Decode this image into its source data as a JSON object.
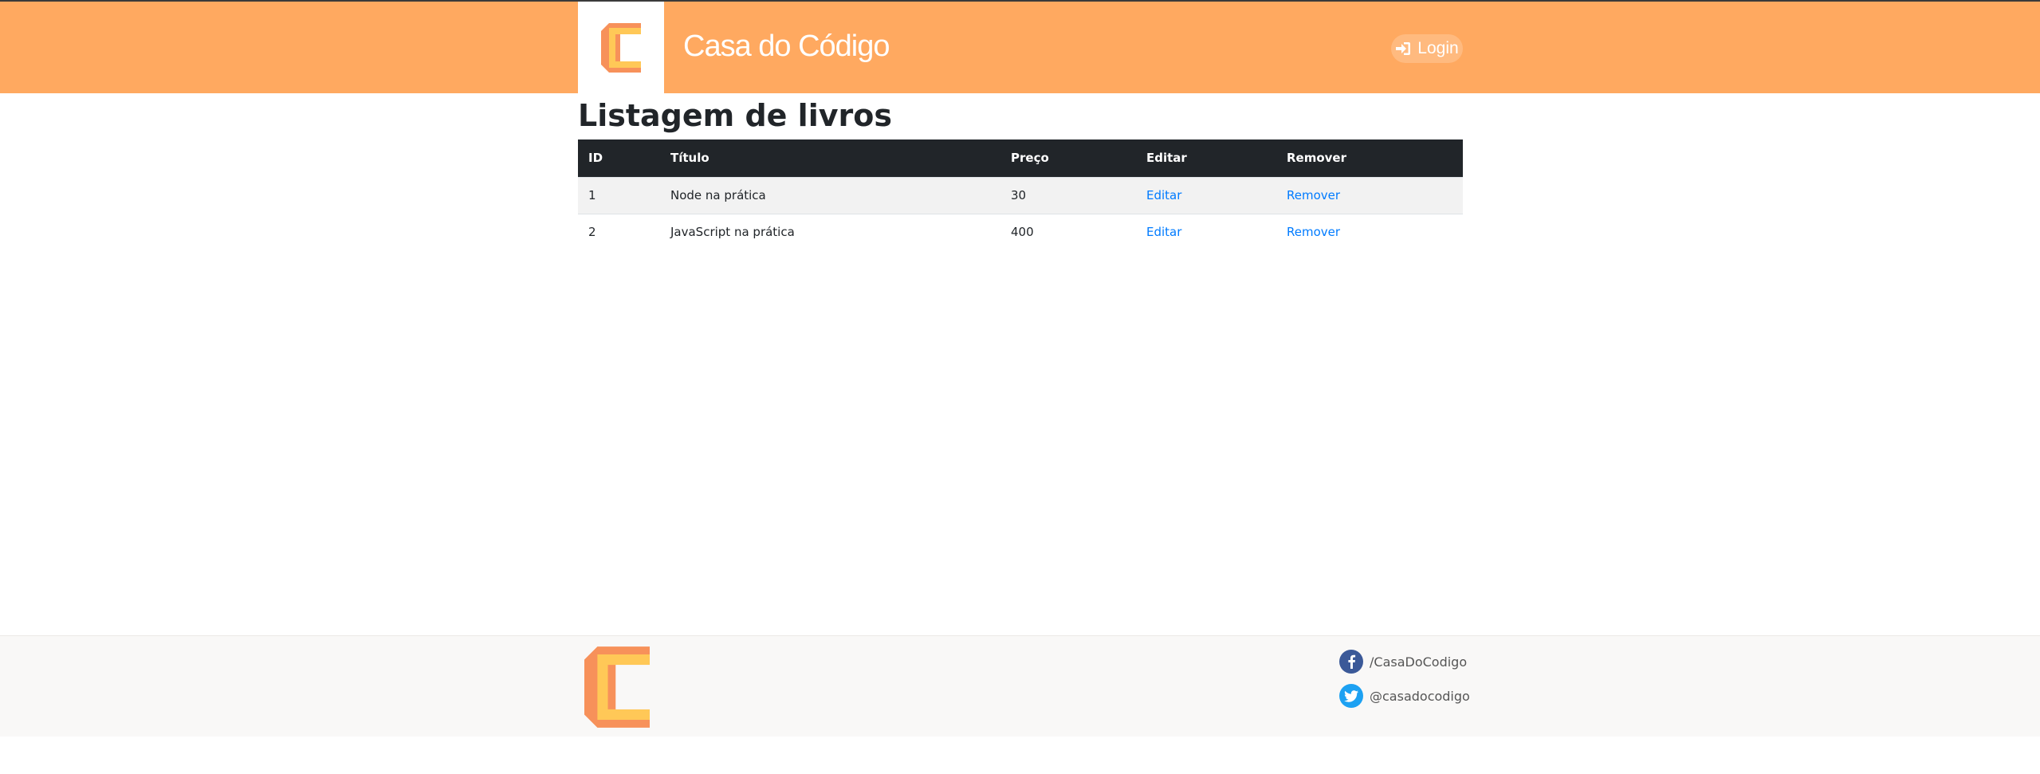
{
  "header": {
    "brand": "Casa do Código",
    "login_label": "Login"
  },
  "main": {
    "title": "Listagem de livros",
    "table": {
      "columns": [
        "ID",
        "Título",
        "Preço",
        "Editar",
        "Remover"
      ],
      "rows": [
        {
          "id": "1",
          "titulo": "Node na prática",
          "preco": "30",
          "editar": "Editar",
          "remover": "Remover"
        },
        {
          "id": "2",
          "titulo": "JavaScript na prática",
          "preco": "400",
          "editar": "Editar",
          "remover": "Remover"
        }
      ]
    }
  },
  "footer": {
    "facebook": "/CasaDoCodigo",
    "twitter": "@casadocodigo"
  },
  "colors": {
    "header_bg": "#ffa960",
    "logo_orange": "#f7915a",
    "logo_yellow": "#ffc857",
    "link": "#007bff",
    "table_head": "#212529",
    "facebook": "#3b5998",
    "twitter": "#1da1f2"
  },
  "icons": {
    "logo": "casa-do-codigo-logo-icon",
    "login": "sign-in-icon",
    "facebook": "facebook-icon",
    "twitter": "twitter-icon"
  }
}
